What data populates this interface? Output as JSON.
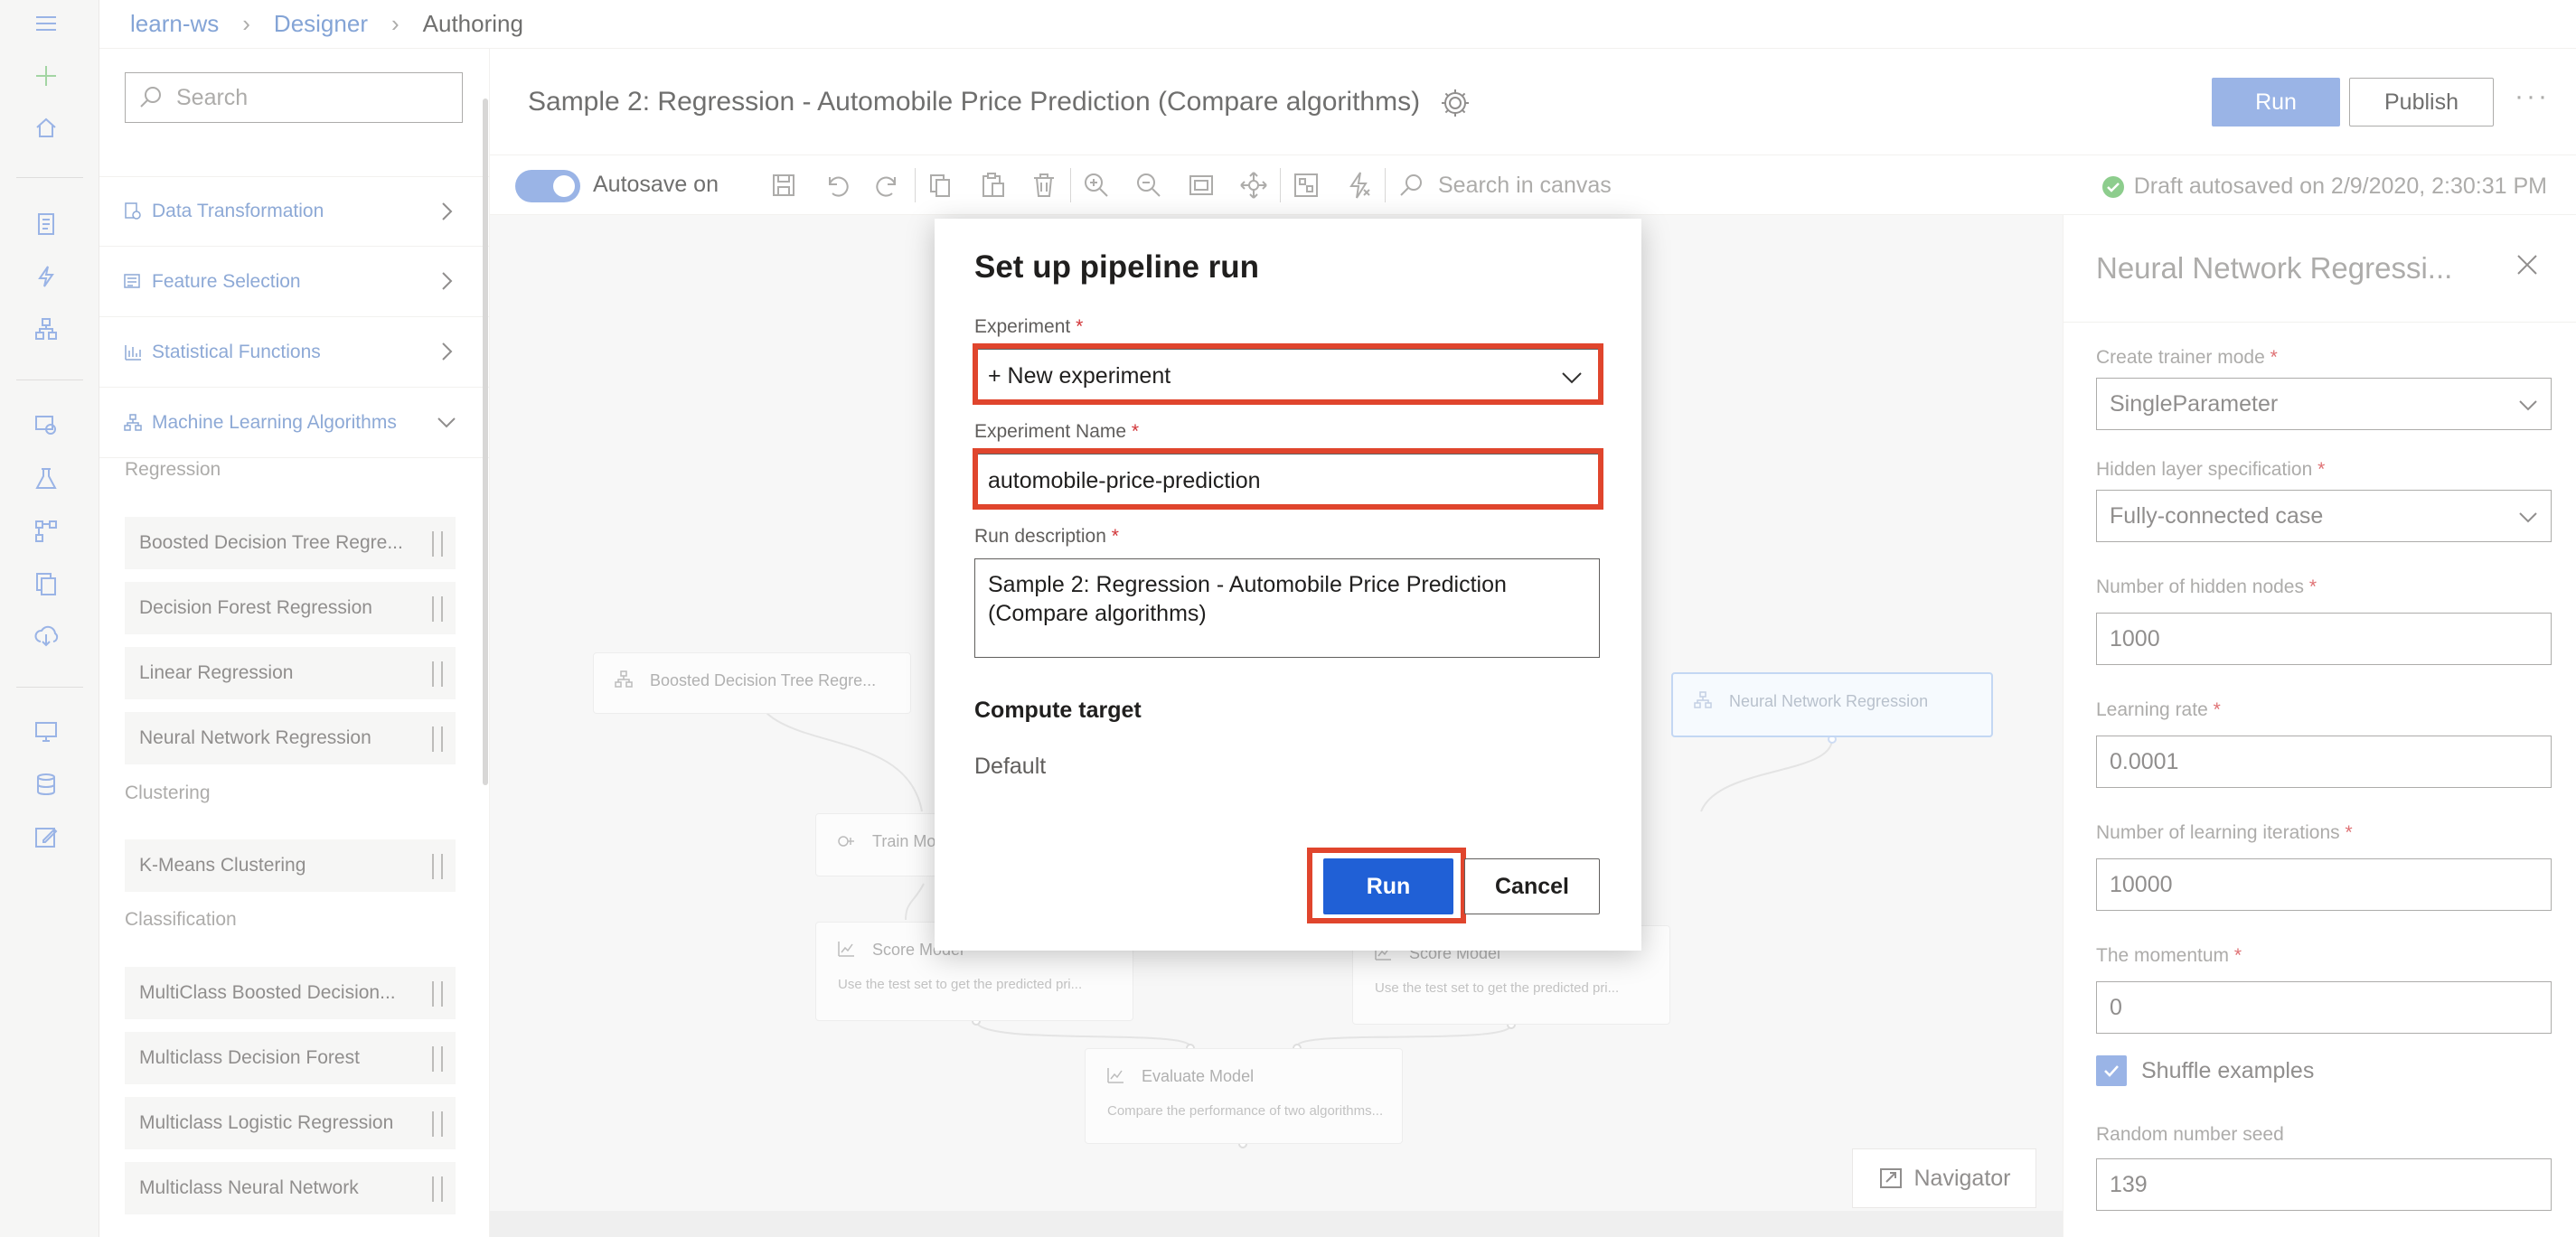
{
  "breadcrumb": {
    "items": [
      "learn-ws",
      "Designer"
    ],
    "current": "Authoring"
  },
  "rail": {
    "icons": [
      "hamburger-menu-icon",
      "plus-icon",
      "home-icon",
      "notebook-icon",
      "automl-icon",
      "designer-icon",
      "datasets-icon",
      "experiments-icon",
      "pipelines-icon",
      "models-icon",
      "endpoints-icon",
      "compute-icon",
      "datastores-icon",
      "data-labeling-icon"
    ]
  },
  "palette": {
    "search_placeholder": "Search",
    "categories": [
      {
        "label": "Data Transformation"
      },
      {
        "label": "Feature Selection"
      },
      {
        "label": "Statistical Functions"
      },
      {
        "label": "Machine Learning Algorithms"
      }
    ],
    "groups": {
      "regression": "Regression",
      "clustering": "Clustering",
      "classification": "Classification"
    },
    "modules": {
      "regression": [
        "Boosted Decision Tree Regre...",
        "Decision Forest Regression",
        "Linear Regression",
        "Neural Network Regression"
      ],
      "clustering": [
        "K-Means Clustering"
      ],
      "classification": [
        "MultiClass Boosted Decision...",
        "Multiclass Decision Forest",
        "Multiclass Logistic Regression",
        "Multiclass Neural Network"
      ]
    }
  },
  "header": {
    "title": "Sample 2: Regression - Automobile Price Prediction (Compare algorithms)",
    "run_label": "Run",
    "publish_label": "Publish",
    "more_label": "···"
  },
  "toolbar": {
    "autosave_label": "Autosave on",
    "search_placeholder": "Search in canvas",
    "draft_status": "Draft autosaved on 2/9/2020, 2:30:31 PM"
  },
  "canvas": {
    "nodes": [
      {
        "title": "Boosted Decision Tree Regre...",
        "subtitle": ""
      },
      {
        "title": "Neural Network Regression",
        "subtitle": ""
      },
      {
        "title": "Train Mo",
        "subtitle": ""
      },
      {
        "title": "Score Model",
        "subtitle": "Use the test set to get the predicted pri..."
      },
      {
        "title": "Score Model",
        "subtitle": "Use the test set to get the predicted pri..."
      },
      {
        "title": "Evaluate Model",
        "subtitle": "Compare the performance of two algorithms..."
      }
    ],
    "navigator_label": "Navigator"
  },
  "properties": {
    "title": "Neural Network Regressi...",
    "fields": {
      "trainer_mode_label": "Create trainer mode",
      "trainer_mode_value": "SingleParameter",
      "hidden_layer_label": "Hidden layer specification",
      "hidden_layer_value": "Fully-connected case",
      "hidden_nodes_label": "Number of hidden nodes",
      "hidden_nodes_value": "1000",
      "learning_rate_label": "Learning rate",
      "learning_rate_value": "0.0001",
      "iterations_label": "Number of learning iterations",
      "iterations_value": "10000",
      "momentum_label": "The momentum",
      "momentum_value": "0",
      "shuffle_label": "Shuffle examples",
      "shuffle_checked": true,
      "seed_label": "Random number seed",
      "seed_value": "139"
    },
    "required_mark": "*"
  },
  "modal": {
    "title": "Set up pipeline run",
    "experiment_label": "Experiment",
    "experiment_value": "+ New experiment",
    "experiment_name_label": "Experiment Name",
    "experiment_name_value": "automobile-price-prediction",
    "run_description_label": "Run description",
    "run_description_value": "Sample 2: Regression - Automobile Price Prediction (Compare algorithms)",
    "compute_target_label": "Compute target",
    "compute_target_value": "Default",
    "run_label": "Run",
    "cancel_label": "Cancel",
    "required_mark": "*"
  },
  "colors": {
    "accent": "#2060d6",
    "accent_light": "#6f94dc",
    "highlight": "#e0452d",
    "link": "#4f7dc4",
    "success": "#5cb85c"
  }
}
